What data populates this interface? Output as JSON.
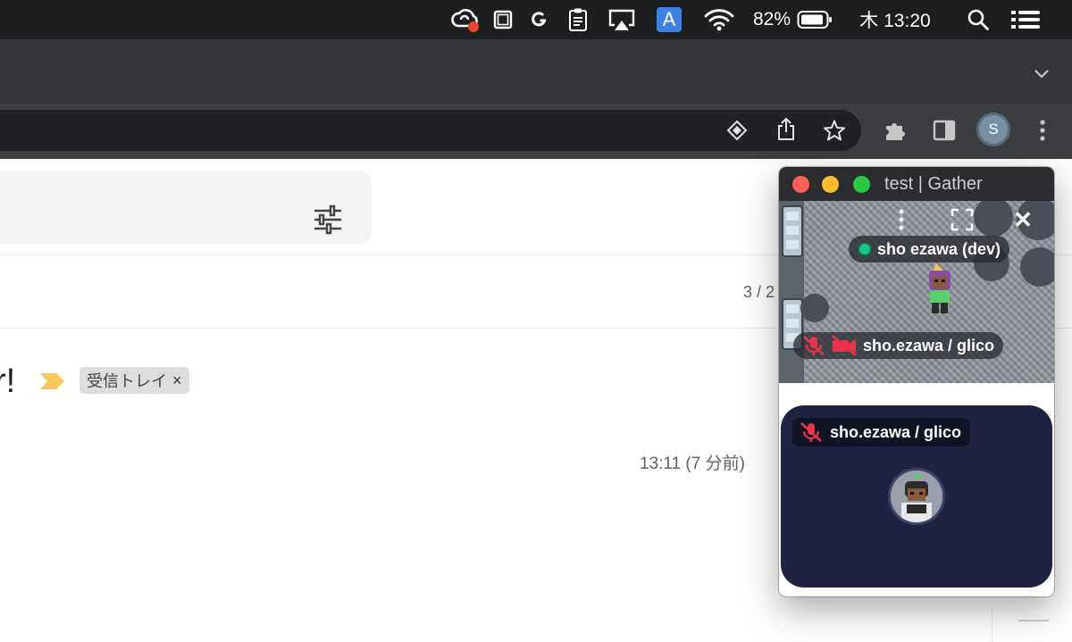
{
  "menubar": {
    "battery_percent": "82%",
    "clock": "木 13:20",
    "input_source": "A",
    "icons": [
      "creative-cloud-icon",
      "screen-icon",
      "grammarly-icon",
      "clipboard-icon",
      "airplay-icon",
      "input-source-icon",
      "wifi-icon",
      "battery-icon",
      "spotlight-search-icon",
      "control-center-icon"
    ]
  },
  "browser": {
    "profile_initial": "S",
    "toolbar_icons": [
      "install-app-icon",
      "share-icon",
      "bookmark-star-icon",
      "extensions-puzzle-icon",
      "side-panel-icon",
      "more-menu-icon"
    ]
  },
  "gmail": {
    "pagination": "3 / 2",
    "subject_fragment": "r!",
    "label_chip": "受信トレイ",
    "label_remove": "×",
    "timestamp": "13:11 (7 分前)",
    "colors": {
      "importance": "#f6c85f",
      "chip_bg": "#dddddd"
    }
  },
  "gather": {
    "window_title": "test | Gather",
    "close_glyph": "✕",
    "map": {
      "dev_user": "sho ezawa (dev)",
      "muted_user": "sho.ezawa / glico"
    },
    "video_tile": {
      "user": "sho.ezawa / glico"
    },
    "colors": {
      "tile_bg": "#1e2342",
      "online": "#19c48a",
      "muted": "#e8334a"
    }
  }
}
